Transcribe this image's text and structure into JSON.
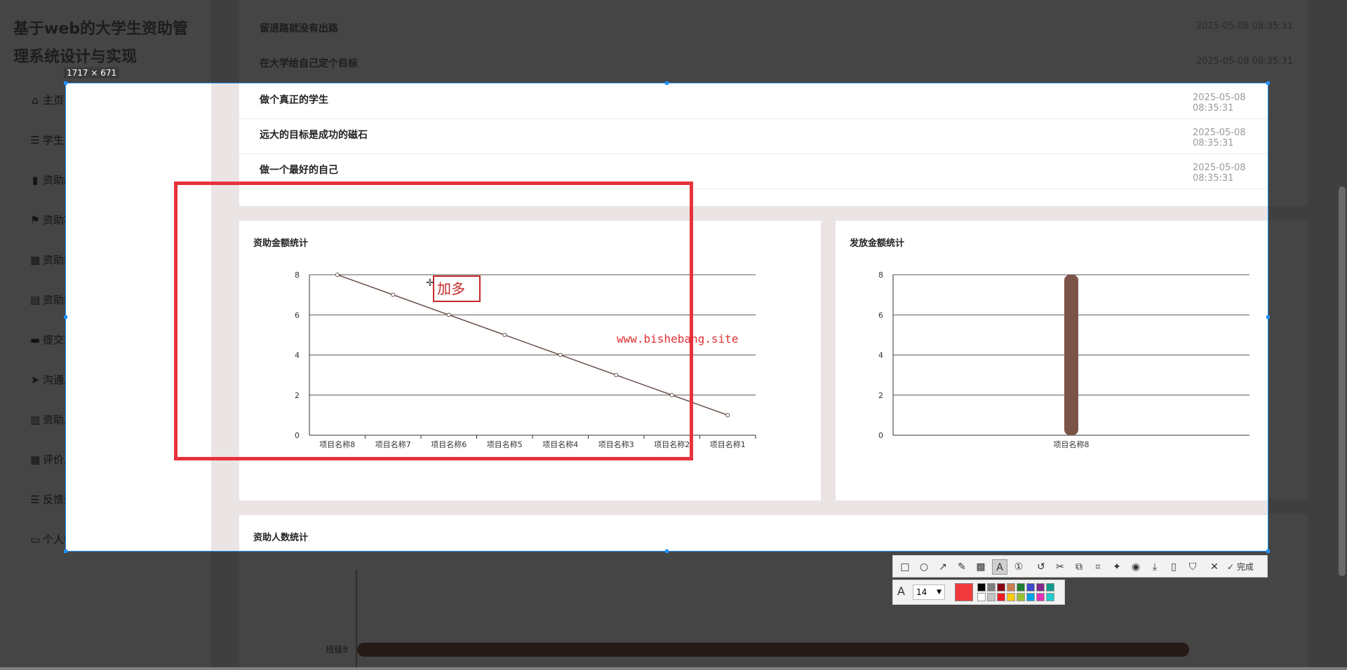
{
  "app": {
    "title": "基于web的大学生资助管理系统设计与实现"
  },
  "sidebar": {
    "items": [
      {
        "label": "主页",
        "icon": "home-icon"
      },
      {
        "label": "学生",
        "icon": "list-icon"
      },
      {
        "label": "资助政策",
        "icon": "chart-icon"
      },
      {
        "label": "资助项目",
        "icon": "flag-icon"
      },
      {
        "label": "资助申请指导",
        "icon": "grid-icon"
      },
      {
        "label": "资助申请",
        "icon": "clipboard-icon"
      },
      {
        "label": "提交复审",
        "icon": "monitor-icon"
      },
      {
        "label": "沟通反馈",
        "icon": "send-icon"
      },
      {
        "label": "资助发放",
        "icon": "bar-chart-icon"
      },
      {
        "label": "评价反馈",
        "icon": "grid-icon"
      },
      {
        "label": "反馈建议",
        "icon": "list-icon"
      },
      {
        "label": "个人中心",
        "icon": "window-icon"
      }
    ]
  },
  "notices": [
    {
      "title": "留退路就没有出路",
      "time": "2025-05-08 08:35:31"
    },
    {
      "title": "在大学给自己定个目标",
      "time": "2025-05-08 08:35:31"
    },
    {
      "title": "做个真正的学生",
      "time": "2025-05-08 08:35:31"
    },
    {
      "title": "远大的目标是成功的磁石",
      "time": "2025-05-08 08:35:31"
    },
    {
      "title": "做一个最好的自己",
      "time": "2025-05-08 08:35:31"
    }
  ],
  "screenshot_tool": {
    "size_label": "1717 × 671",
    "text_input": "加多",
    "watermark": "www.bishebang.site",
    "done_label": "完成",
    "font_size": "14",
    "current_color": "#f23a3c",
    "palette": [
      "#000000",
      "#7f7f7f",
      "#880015",
      "#c87e51",
      "#1d7d32",
      "#3f48cc",
      "#7f2a8a",
      "#11998e",
      "#ffffff",
      "#c3c3c3",
      "#ed1c24",
      "#ffc90e",
      "#99c232",
      "#00a2e8",
      "#e432b7",
      "#22cccc"
    ],
    "tools": [
      "rect-icon",
      "ellipse-icon",
      "arrow-icon",
      "pen-icon",
      "mosaic-icon",
      "text-icon",
      "number-icon",
      "undo-icon",
      "scissors-icon",
      "copy-icon",
      "ocr-icon",
      "pin-icon",
      "record-icon",
      "download-icon",
      "phone-icon",
      "bookmark-icon",
      "close-icon",
      "check-icon"
    ]
  },
  "cards": {
    "funding_amount": {
      "title": "资助金额统计"
    },
    "payout_amount": {
      "title": "发放金额统计"
    },
    "people_count": {
      "title": "资助人数统计"
    }
  },
  "chart_data": [
    {
      "type": "line",
      "title": "资助金额统计",
      "categories": [
        "项目名称8",
        "项目名称7",
        "项目名称6",
        "项目名称5",
        "项目名称4",
        "项目名称3",
        "项目名称2",
        "项目名称1"
      ],
      "values": [
        8,
        7,
        6,
        5,
        4,
        3,
        2,
        1
      ],
      "ylim": [
        0,
        8
      ],
      "yticks": [
        0,
        2,
        4,
        6,
        8
      ],
      "grid": true,
      "color": "#6b544e"
    },
    {
      "type": "bar",
      "title": "发放金额统计",
      "categories": [
        "项目名称8"
      ],
      "values": [
        8
      ],
      "ylim": [
        0,
        8
      ],
      "yticks": [
        0,
        2,
        4,
        6,
        8
      ],
      "grid": true,
      "color": "#7c5447"
    },
    {
      "type": "bar",
      "title": "资助人数统计",
      "categories": [
        "班级8"
      ],
      "values": [
        8
      ],
      "orientation": "horizontal",
      "color": "#4a342c"
    }
  ]
}
